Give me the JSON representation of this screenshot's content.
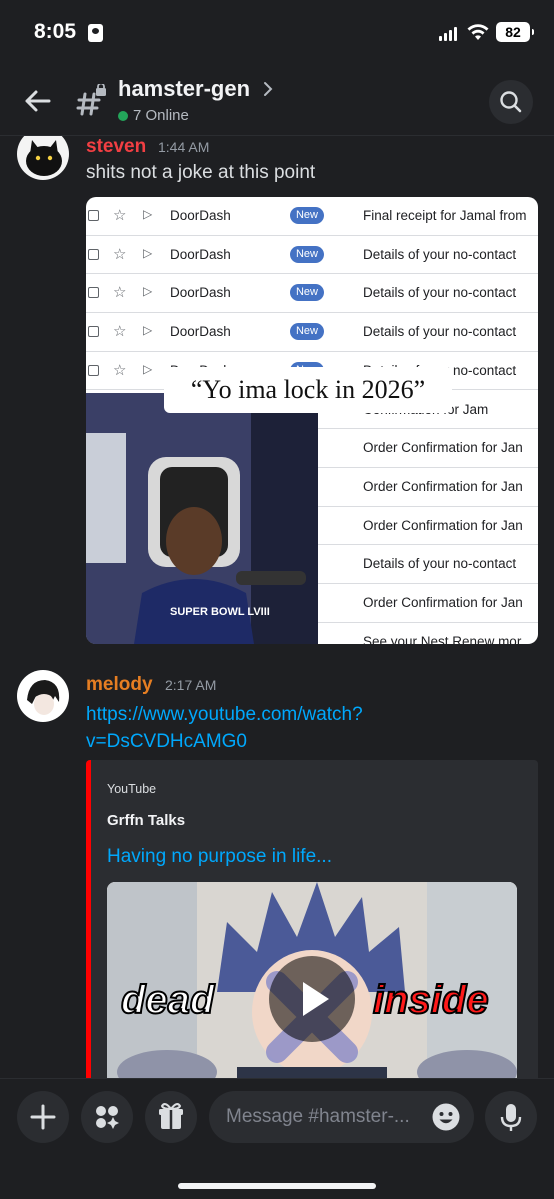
{
  "status_bar": {
    "time": "8:05",
    "battery": "82"
  },
  "header": {
    "channel_name": "hamster-gen",
    "online_text": "7 Online"
  },
  "messages": [
    {
      "author": "steven",
      "author_color": "#f23f43",
      "time": "1:44 AM",
      "text": "shits not a joke at this point",
      "attachment": {
        "emails": [
          {
            "sender": "DoorDash",
            "badge": "New",
            "subject": "Final receipt for Jamal from"
          },
          {
            "sender": "DoorDash",
            "badge": "New",
            "subject": "Details of your no-contact"
          },
          {
            "sender": "DoorDash",
            "badge": "New",
            "subject": "Details of your no-contact"
          },
          {
            "sender": "DoorDash",
            "badge": "New",
            "subject": "Details of your no-contact"
          },
          {
            "sender": "DoorDash",
            "badge": "New",
            "subject": "Details of your no-contact"
          },
          {
            "sender": "",
            "badge": "",
            "subject": "Confirmation for Jam"
          },
          {
            "sender": "",
            "badge": "",
            "subject": "Order Confirmation for Jan"
          },
          {
            "sender": "",
            "badge": "",
            "subject": "Order Confirmation for Jan"
          },
          {
            "sender": "",
            "badge": "",
            "subject": "Order Confirmation for Jan"
          },
          {
            "sender": "",
            "badge": "",
            "subject": "Details of your no-contact"
          },
          {
            "sender": "",
            "badge": "",
            "subject": "Order Confirmation for Jan"
          },
          {
            "sender": "",
            "badge": "",
            "subject": "See your Nest Renew mor"
          }
        ],
        "caption": "“Yo ima lock in 2026”",
        "shirt_text": "SUPER BOWL LVIII"
      }
    },
    {
      "author": "melody",
      "author_color": "#e67e22",
      "time": "2:17 AM",
      "link_line1": "https://www.youtube.com/watch?",
      "link_line2": "v=DsCVDHcAMG0",
      "embed": {
        "provider": "YouTube",
        "author": "Grffn Talks",
        "title": "Having no purpose in life...",
        "thumb_left": "dead",
        "thumb_right": "inside"
      }
    }
  ],
  "composer": {
    "placeholder": "Message #hamster-..."
  },
  "colors": {
    "link": "#00a8fc",
    "online": "#23a55a",
    "embed_bar": "#ff0000"
  }
}
